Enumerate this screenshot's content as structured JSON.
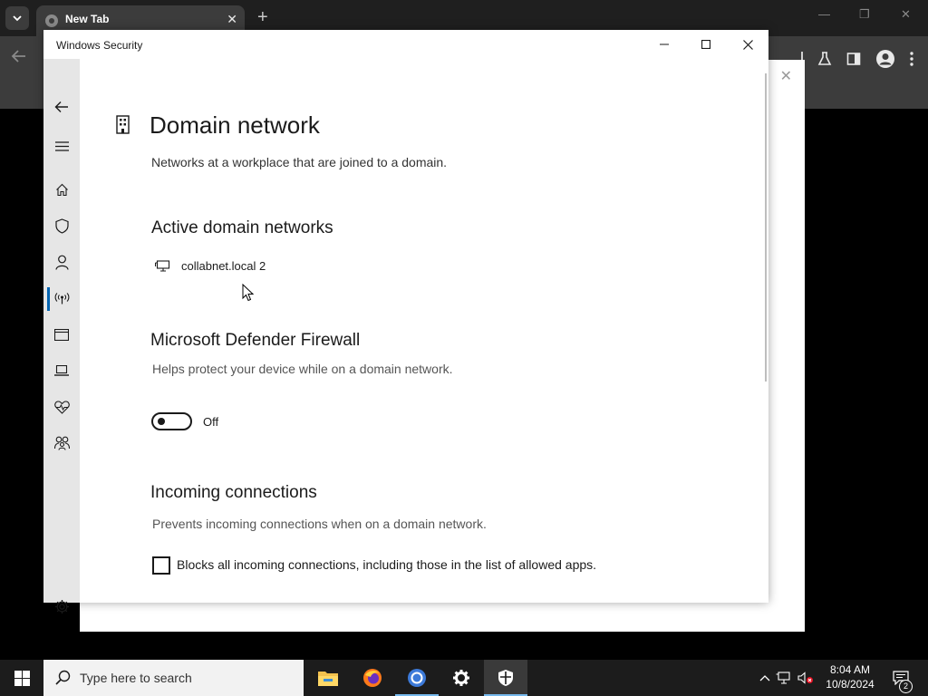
{
  "browser": {
    "tab_title": "New Tab",
    "tab_close": "✕",
    "new_tab": "+",
    "minimize": "—",
    "restore": "❐",
    "close": "✕",
    "page_close": "✕"
  },
  "security_window": {
    "title": "Windows Security",
    "sidebar": {
      "items": [
        "back",
        "menu",
        "home",
        "virus-threat-protection",
        "account-protection",
        "firewall-network-protection",
        "app-browser-control",
        "device-security",
        "device-performance-health",
        "family-options",
        "settings"
      ],
      "active": "firewall-network-protection"
    },
    "header": {
      "title": "Domain network",
      "description": "Networks at a workplace that are joined to a domain."
    },
    "active_networks": {
      "heading": "Active domain networks",
      "networks": [
        "collabnet.local 2"
      ]
    },
    "firewall": {
      "heading": "Microsoft Defender Firewall",
      "description": "Helps protect your device while on a domain network.",
      "toggle_state": "Off"
    },
    "incoming": {
      "heading": "Incoming connections",
      "description": "Prevents incoming connections when on a domain network.",
      "checkbox_label": "Blocks all incoming connections, including those in the list of allowed apps.",
      "checked": false
    }
  },
  "taskbar": {
    "search_placeholder": "Type here to search",
    "apps": [
      "file-explorer",
      "firefox",
      "chrome",
      "settings",
      "windows-security"
    ],
    "active_app": "windows-security",
    "time": "8:04 AM",
    "date": "10/8/2024",
    "notification_count": "2"
  },
  "colors": {
    "accent": "#0063b1",
    "sidebar_bg": "#e6e6e6",
    "taskbar_bg": "#1c1c1c",
    "chrome_toolbar": "#3c3c3c"
  }
}
